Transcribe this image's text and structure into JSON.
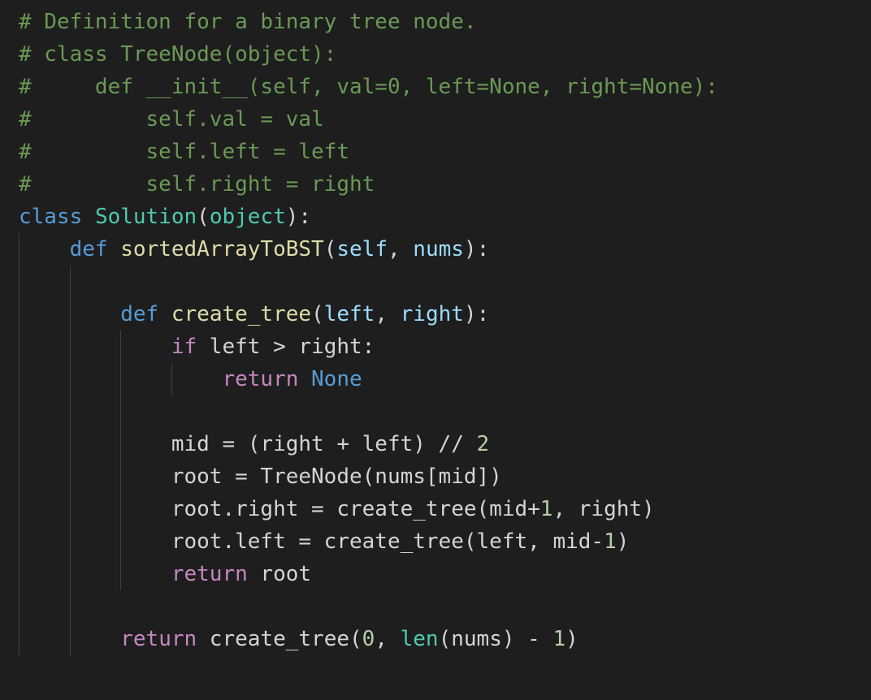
{
  "editor": {
    "language": "python",
    "theme_colors": {
      "background": "#1e1e1e",
      "comment": "#6a9955",
      "keyword": "#569cd6",
      "control": "#c586c0",
      "class": "#4ec9b0",
      "function": "#dcdcaa",
      "parameter": "#9cdcfe",
      "number": "#b5cea8",
      "text": "#d4d4d4",
      "indent_guide": "#404040"
    },
    "lines": [
      [
        {
          "t": "comment",
          "v": "# Definition for a binary tree node."
        }
      ],
      [
        {
          "t": "comment",
          "v": "# class TreeNode(object):"
        }
      ],
      [
        {
          "t": "comment",
          "v": "#     def __init__(self, val=0, left=None, right=None):"
        }
      ],
      [
        {
          "t": "comment",
          "v": "#         self.val = val"
        }
      ],
      [
        {
          "t": "comment",
          "v": "#         self.left = left"
        }
      ],
      [
        {
          "t": "comment",
          "v": "#         self.right = right"
        }
      ],
      [
        {
          "t": "keyword",
          "v": "class"
        },
        {
          "t": "plain",
          "v": " "
        },
        {
          "t": "class",
          "v": "Solution"
        },
        {
          "t": "plain",
          "v": "("
        },
        {
          "t": "builtin",
          "v": "object"
        },
        {
          "t": "plain",
          "v": "):"
        }
      ],
      [
        {
          "t": "plain",
          "v": "    "
        },
        {
          "t": "keyword",
          "v": "def"
        },
        {
          "t": "plain",
          "v": " "
        },
        {
          "t": "function",
          "v": "sortedArrayToBST"
        },
        {
          "t": "plain",
          "v": "("
        },
        {
          "t": "param",
          "v": "self"
        },
        {
          "t": "plain",
          "v": ", "
        },
        {
          "t": "param",
          "v": "nums"
        },
        {
          "t": "plain",
          "v": "):"
        }
      ],
      [
        {
          "t": "plain",
          "v": ""
        }
      ],
      [
        {
          "t": "plain",
          "v": "        "
        },
        {
          "t": "keyword",
          "v": "def"
        },
        {
          "t": "plain",
          "v": " "
        },
        {
          "t": "function",
          "v": "create_tree"
        },
        {
          "t": "plain",
          "v": "("
        },
        {
          "t": "param",
          "v": "left"
        },
        {
          "t": "plain",
          "v": ", "
        },
        {
          "t": "param",
          "v": "right"
        },
        {
          "t": "plain",
          "v": "):"
        }
      ],
      [
        {
          "t": "plain",
          "v": "            "
        },
        {
          "t": "control",
          "v": "if"
        },
        {
          "t": "plain",
          "v": " left > right:"
        }
      ],
      [
        {
          "t": "plain",
          "v": "                "
        },
        {
          "t": "control",
          "v": "return"
        },
        {
          "t": "plain",
          "v": " "
        },
        {
          "t": "constant",
          "v": "None"
        }
      ],
      [
        {
          "t": "plain",
          "v": ""
        }
      ],
      [
        {
          "t": "plain",
          "v": "            mid = (right + left) // "
        },
        {
          "t": "number",
          "v": "2"
        }
      ],
      [
        {
          "t": "plain",
          "v": "            root = TreeNode(nums[mid])"
        }
      ],
      [
        {
          "t": "plain",
          "v": "            root.right = create_tree(mid+"
        },
        {
          "t": "number",
          "v": "1"
        },
        {
          "t": "plain",
          "v": ", right)"
        }
      ],
      [
        {
          "t": "plain",
          "v": "            root.left = create_tree(left, mid-"
        },
        {
          "t": "number",
          "v": "1"
        },
        {
          "t": "plain",
          "v": ")"
        }
      ],
      [
        {
          "t": "plain",
          "v": "            "
        },
        {
          "t": "control",
          "v": "return"
        },
        {
          "t": "plain",
          "v": " root"
        }
      ],
      [
        {
          "t": "plain",
          "v": ""
        }
      ],
      [
        {
          "t": "plain",
          "v": "        "
        },
        {
          "t": "control",
          "v": "return"
        },
        {
          "t": "plain",
          "v": " create_tree("
        },
        {
          "t": "number",
          "v": "0"
        },
        {
          "t": "plain",
          "v": ", "
        },
        {
          "t": "builtin",
          "v": "len"
        },
        {
          "t": "plain",
          "v": "(nums) - "
        },
        {
          "t": "number",
          "v": "1"
        },
        {
          "t": "plain",
          "v": ")"
        }
      ]
    ]
  }
}
